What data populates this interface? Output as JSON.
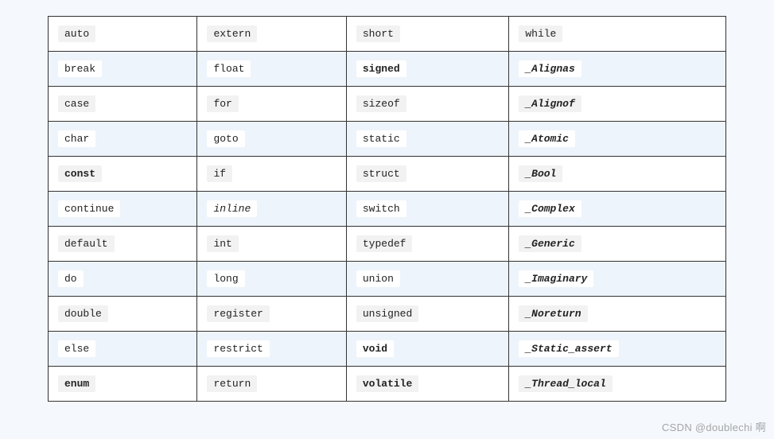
{
  "table": {
    "rows": [
      {
        "alt": false,
        "cells": [
          {
            "text": "auto",
            "bold": false,
            "italic": false
          },
          {
            "text": "extern",
            "bold": false,
            "italic": false
          },
          {
            "text": "short",
            "bold": false,
            "italic": false
          },
          {
            "text": "while",
            "bold": false,
            "italic": false
          }
        ]
      },
      {
        "alt": true,
        "cells": [
          {
            "text": "break",
            "bold": false,
            "italic": false
          },
          {
            "text": "float",
            "bold": false,
            "italic": false
          },
          {
            "text": "signed",
            "bold": true,
            "italic": false
          },
          {
            "text": "_Alignas",
            "bold": true,
            "italic": true
          }
        ]
      },
      {
        "alt": false,
        "cells": [
          {
            "text": "case",
            "bold": false,
            "italic": false
          },
          {
            "text": "for",
            "bold": false,
            "italic": false
          },
          {
            "text": "sizeof",
            "bold": false,
            "italic": false
          },
          {
            "text": "_Alignof",
            "bold": true,
            "italic": true
          }
        ]
      },
      {
        "alt": true,
        "cells": [
          {
            "text": "char",
            "bold": false,
            "italic": false
          },
          {
            "text": "goto",
            "bold": false,
            "italic": false
          },
          {
            "text": "static",
            "bold": false,
            "italic": false
          },
          {
            "text": "_Atomic",
            "bold": true,
            "italic": true
          }
        ]
      },
      {
        "alt": false,
        "cells": [
          {
            "text": "const",
            "bold": true,
            "italic": false
          },
          {
            "text": "if",
            "bold": false,
            "italic": false
          },
          {
            "text": "struct",
            "bold": false,
            "italic": false
          },
          {
            "text": "_Bool",
            "bold": true,
            "italic": true
          }
        ]
      },
      {
        "alt": true,
        "cells": [
          {
            "text": "continue",
            "bold": false,
            "italic": false
          },
          {
            "text": "inline",
            "bold": false,
            "italic": true
          },
          {
            "text": "switch",
            "bold": false,
            "italic": false
          },
          {
            "text": "_Complex",
            "bold": true,
            "italic": true
          }
        ]
      },
      {
        "alt": false,
        "cells": [
          {
            "text": "default",
            "bold": false,
            "italic": false
          },
          {
            "text": "int",
            "bold": false,
            "italic": false
          },
          {
            "text": "typedef",
            "bold": false,
            "italic": false
          },
          {
            "text": "_Generic",
            "bold": true,
            "italic": true
          }
        ]
      },
      {
        "alt": true,
        "cells": [
          {
            "text": "do",
            "bold": false,
            "italic": false
          },
          {
            "text": "long",
            "bold": false,
            "italic": false
          },
          {
            "text": "union",
            "bold": false,
            "italic": false
          },
          {
            "text": "_Imaginary",
            "bold": true,
            "italic": true
          }
        ]
      },
      {
        "alt": false,
        "cells": [
          {
            "text": "double",
            "bold": false,
            "italic": false
          },
          {
            "text": "register",
            "bold": false,
            "italic": false
          },
          {
            "text": "unsigned",
            "bold": false,
            "italic": false
          },
          {
            "text": "_Noreturn",
            "bold": true,
            "italic": true
          }
        ]
      },
      {
        "alt": true,
        "cells": [
          {
            "text": "else",
            "bold": false,
            "italic": false
          },
          {
            "text": "restrict",
            "bold": false,
            "italic": false
          },
          {
            "text": "void",
            "bold": true,
            "italic": false
          },
          {
            "text": "_Static_assert",
            "bold": true,
            "italic": true
          }
        ]
      },
      {
        "alt": false,
        "cells": [
          {
            "text": "enum",
            "bold": true,
            "italic": false
          },
          {
            "text": "return",
            "bold": false,
            "italic": false
          },
          {
            "text": "volatile",
            "bold": true,
            "italic": false
          },
          {
            "text": "_Thread_local",
            "bold": true,
            "italic": true
          }
        ]
      }
    ]
  },
  "watermark": "CSDN @doublechi 啊"
}
